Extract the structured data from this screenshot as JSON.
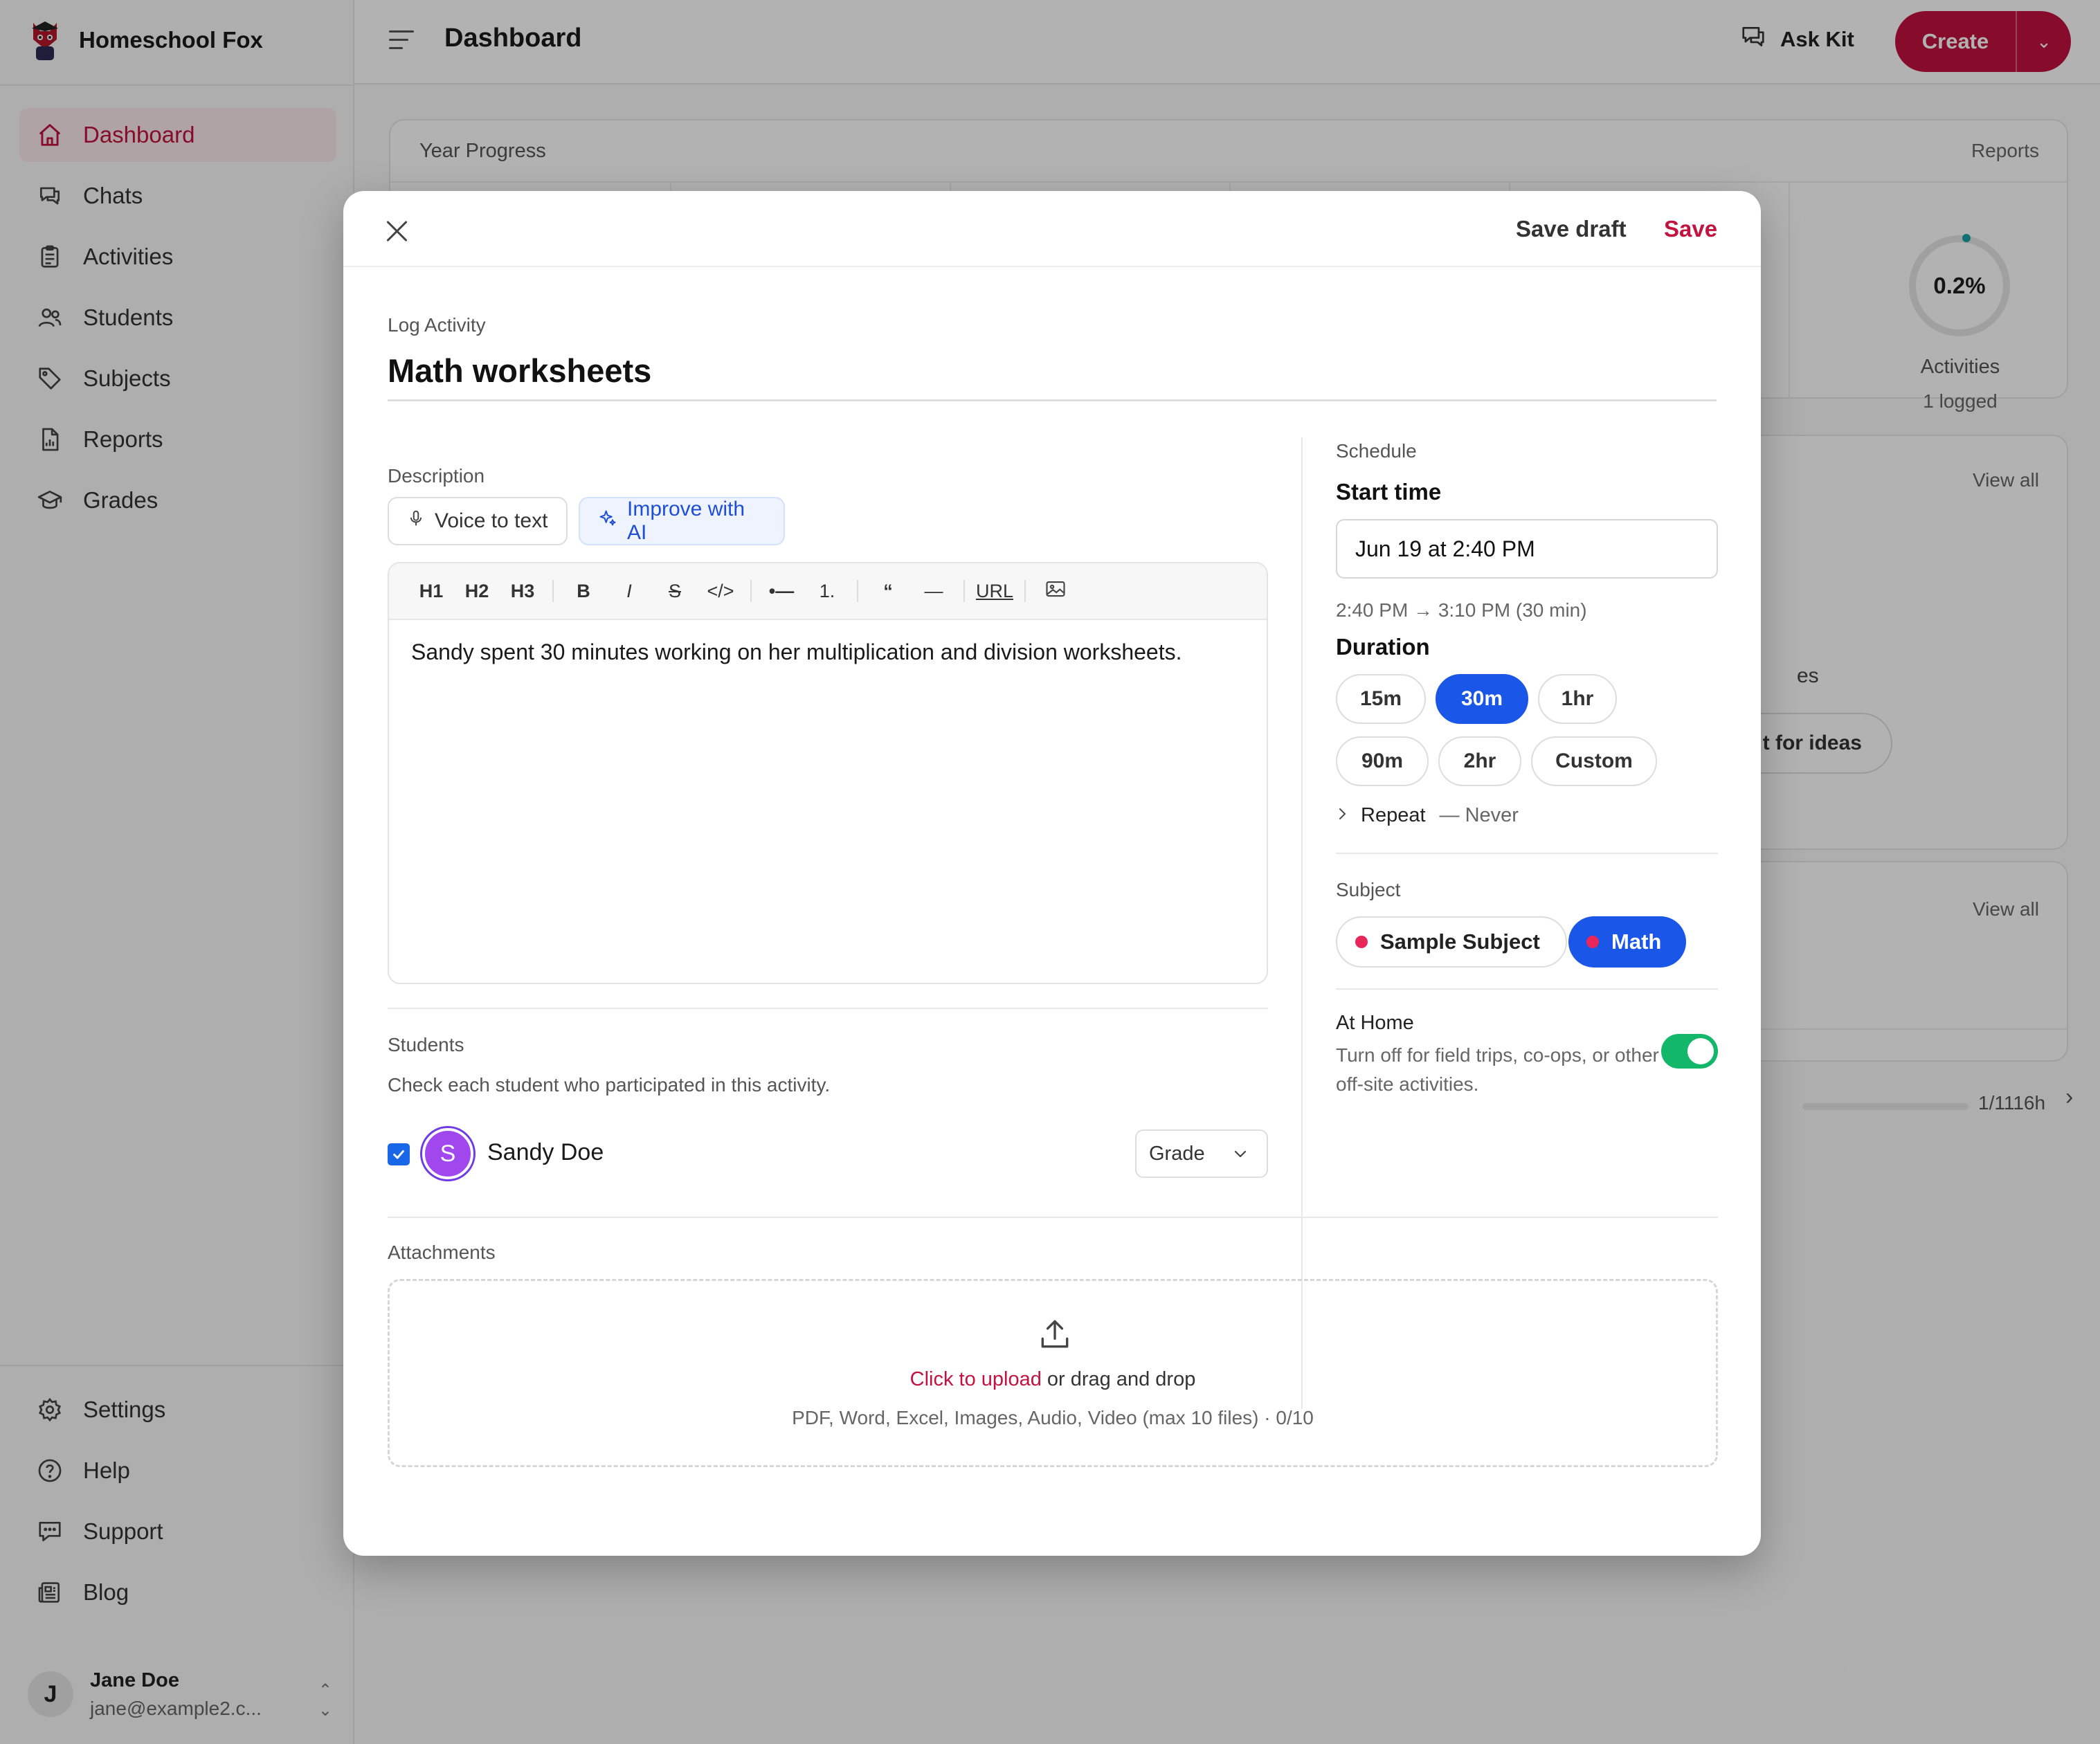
{
  "app": {
    "brand": "Homeschool Fox",
    "page_title": "Dashboard"
  },
  "sidebar": {
    "items": [
      {
        "label": "Dashboard",
        "icon": "home-icon",
        "active": true
      },
      {
        "label": "Chats",
        "icon": "chat-icon"
      },
      {
        "label": "Activities",
        "icon": "clipboard-icon"
      },
      {
        "label": "Students",
        "icon": "users-icon"
      },
      {
        "label": "Subjects",
        "icon": "tag-icon"
      },
      {
        "label": "Reports",
        "icon": "report-icon"
      },
      {
        "label": "Grades",
        "icon": "graduation-cap-icon"
      }
    ],
    "bottom_items": [
      {
        "label": "Settings",
        "icon": "gear-icon"
      },
      {
        "label": "Help",
        "icon": "help-circle-icon"
      },
      {
        "label": "Support",
        "icon": "support-chat-icon"
      },
      {
        "label": "Blog",
        "icon": "newspaper-icon"
      }
    ],
    "user": {
      "initial": "J",
      "name": "Jane Doe",
      "email": "jane@example2.c..."
    }
  },
  "header": {
    "ask_kit": "Ask Kit",
    "create": "Create"
  },
  "background": {
    "year_progress": "Year Progress",
    "reports_link": "Reports",
    "activities_percent": "0.2%",
    "activities_label": "Activities",
    "activities_sub": "1 logged",
    "view_all_1": "View all",
    "partial_text": "es",
    "ideas_button": "t for ideas",
    "view_all_2": "View all",
    "hours": "1/1116h"
  },
  "modal": {
    "save_draft": "Save draft",
    "save": "Save",
    "kicker": "Log Activity",
    "title": "Math worksheets",
    "description_label": "Description",
    "voice_to_text": "Voice to text",
    "improve_with_ai": "Improve with AI",
    "toolbar": [
      "H1",
      "H2",
      "H3",
      "B",
      "I",
      "S",
      "</>",
      "•—",
      "1.",
      "“",
      "—",
      "URL"
    ],
    "description_text": "Sandy spent 30 minutes working on her multiplication and division worksheets.",
    "students_label": "Students",
    "students_help": "Check each student who participated in this activity.",
    "student": {
      "initial": "S",
      "name": "Sandy Doe",
      "checked": true
    },
    "grade_placeholder": "Grade",
    "schedule_label": "Schedule",
    "start_time_label": "Start time",
    "start_time_value": "Jun 19 at 2:40 PM",
    "time_range": "2:40 PM → 3:10 PM (30 min)",
    "duration_label": "Duration",
    "durations": [
      "15m",
      "30m",
      "1hr",
      "90m",
      "2hr",
      "Custom"
    ],
    "duration_selected": "30m",
    "repeat_label": "Repeat",
    "repeat_value": "— Never",
    "subject_label": "Subject",
    "subjects": [
      "Sample Subject",
      "Math"
    ],
    "subject_selected": "Math",
    "at_home_label": "At Home",
    "at_home_help": "Turn off for field trips, co-ops, or other off-site activities.",
    "at_home_on": true,
    "attachments_label": "Attachments",
    "upload_link": "Click to upload",
    "upload_rest": " or drag and drop",
    "upload_types": "PDF, Word, Excel, Images, Audio, Video (max 10 files) · 0/10"
  },
  "colors": {
    "brand": "#c2123f",
    "selected": "#1a56e8",
    "toggle_on": "#12b76a",
    "subject_dot": "#e8265a"
  }
}
